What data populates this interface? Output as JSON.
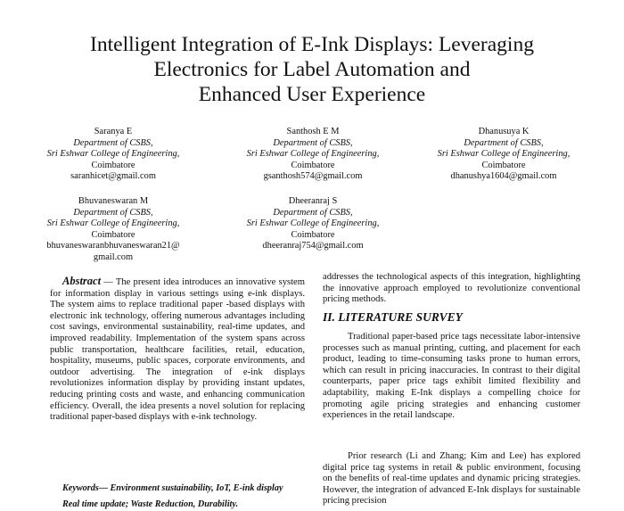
{
  "paper": {
    "title_lines": [
      "Intelligent Integration of E-Ink Displays: Leveraging",
      "Electronics for Label Automation and",
      "Enhanced User Experience"
    ],
    "authors": [
      {
        "name": "Saranya E",
        "dept": "Department of CSBS,",
        "college": "Sri Eshwar College of Engineering,",
        "city": "Coimbatore",
        "email": "saranhicet@gmail.com"
      },
      {
        "name": "Santhosh E M",
        "dept": "Department of CSBS,",
        "college": "Sri Eshwar College of Engineering,",
        "city": "Coimbatore",
        "email": "gsanthosh574@gmail.com"
      },
      {
        "name": "Dhanusuya K",
        "dept": "Department of CSBS,",
        "college": "Sri Eshwar College of Engineering,",
        "city": "Coimbatore",
        "email": "dhanushya1604@gmail.com"
      },
      {
        "name": "Bhuvaneswaran M",
        "dept": "Department of CSBS,",
        "college": "Sri Eshwar College of Engineering,",
        "city": "Coimbatore",
        "email_line1": "bhuvaneswaranbhuvaneswaran21@",
        "email_line2": "gmail.com"
      },
      {
        "name": "Dheeranraj S",
        "dept": "Department of CSBS,",
        "college": "Sri Eshwar College of Engineering,",
        "city": "Coimbatore",
        "email": "dheeranraj754@gmail.com"
      }
    ],
    "abstract": {
      "heading": "Abstract",
      "dash": " — ",
      "text": "The present idea introduces an innovative system for information display in various settings using e-ink displays. The system aims to replace traditional paper -based displays with electronic ink technology, offering numerous advantages including cost savings, environmental sustainability, real-time updates, and improved readability. Implementation of the system spans across public transportation, healthcare facilities, retail, education, hospitality, museums, public spaces, corporate environments, and outdoor advertising. The integration of e-ink displays revolutionizes information display by providing instant updates, reducing printing costs and waste, and enhancing communication efficiency. Overall, the idea presents a novel solution for replacing traditional paper-based displays with e-ink technology."
    },
    "keywords": {
      "line1": "Keywords— Environment sustainability, IoT, E-ink display",
      "line2": "Real time update; Waste Reduction, Durability."
    },
    "right_intro": "addresses the technological aspects of this integration, highlighting the innovative approach employed to revolutionize conventional pricing methods.",
    "section_heading": "II.  LITERATURE SURVEY",
    "para1": "Traditional paper-based price tags necessitate labor-intensive processes such as manual printing, cutting, and placement for each product, leading to time-consuming tasks prone to human errors, which can result in pricing inaccuracies. In contrast to their digital counterparts, paper price tags exhibit limited flexibility and adaptability, making E-Ink displays a compelling choice for promoting agile pricing strategies and enhancing customer experiences in the retail landscape.",
    "para2": "Prior research (Li and Zhang; Kim and Lee) has explored digital price tag systems in retail & public environment, focusing on the benefits of real-time updates and dynamic pricing strategies. However, the integration of advanced E-Ink displays for sustainable pricing precision"
  }
}
